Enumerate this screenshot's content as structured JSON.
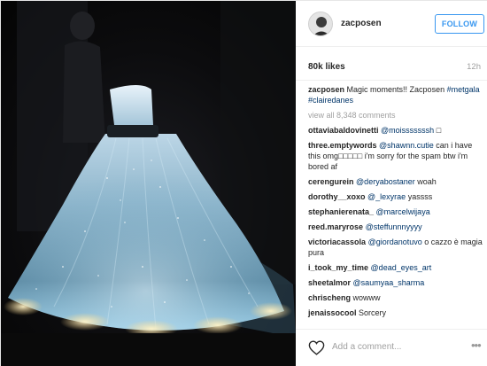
{
  "header": {
    "username": "zacposen",
    "follow_label": "FOLLOW"
  },
  "meta": {
    "likes": "80k likes",
    "time": "12h"
  },
  "caption": {
    "user": "zacposen",
    "text": "Magic moments!! Zacposen",
    "tags": "#metgala #clairedanes"
  },
  "view_all": "view all 8,348 comments",
  "comments": [
    {
      "user": "ottaviabaldovinetti",
      "text": "@moisssssssh □"
    },
    {
      "user": "three.emptywords",
      "text": "@shawnn.cutie can i have this omg□□□□□ i'm sorry for the spam btw i'm bored af"
    },
    {
      "user": "cerengurein",
      "text": "@deryabostaner woah"
    },
    {
      "user": "dorothy__xoxo",
      "text": "@_lexyrae yassss"
    },
    {
      "user": "stephanierenata_",
      "text": "@marcelwijaya"
    },
    {
      "user": "reed.maryrose",
      "text": "@steffunnnyyyy"
    },
    {
      "user": "victoriacassola",
      "text": "@giordanotuvo o cazzo è magia pura"
    },
    {
      "user": "i_took_my_time",
      "text": "@dead_eyes_art"
    },
    {
      "user": "sheetalmor",
      "text": "@saumyaa_sharma"
    },
    {
      "user": "chrischeng",
      "text": "wowww"
    },
    {
      "user": "jenaissocool",
      "text": "Sorcery"
    }
  ],
  "footer": {
    "add_comment_placeholder": "Add a comment...",
    "more_label": "•••"
  },
  "colors": {
    "accent": "#3897f0",
    "hashtag": "#003569",
    "muted": "#a0a0a0"
  },
  "icons": {
    "like": "heart-outline-icon",
    "more": "more-options-icon"
  }
}
